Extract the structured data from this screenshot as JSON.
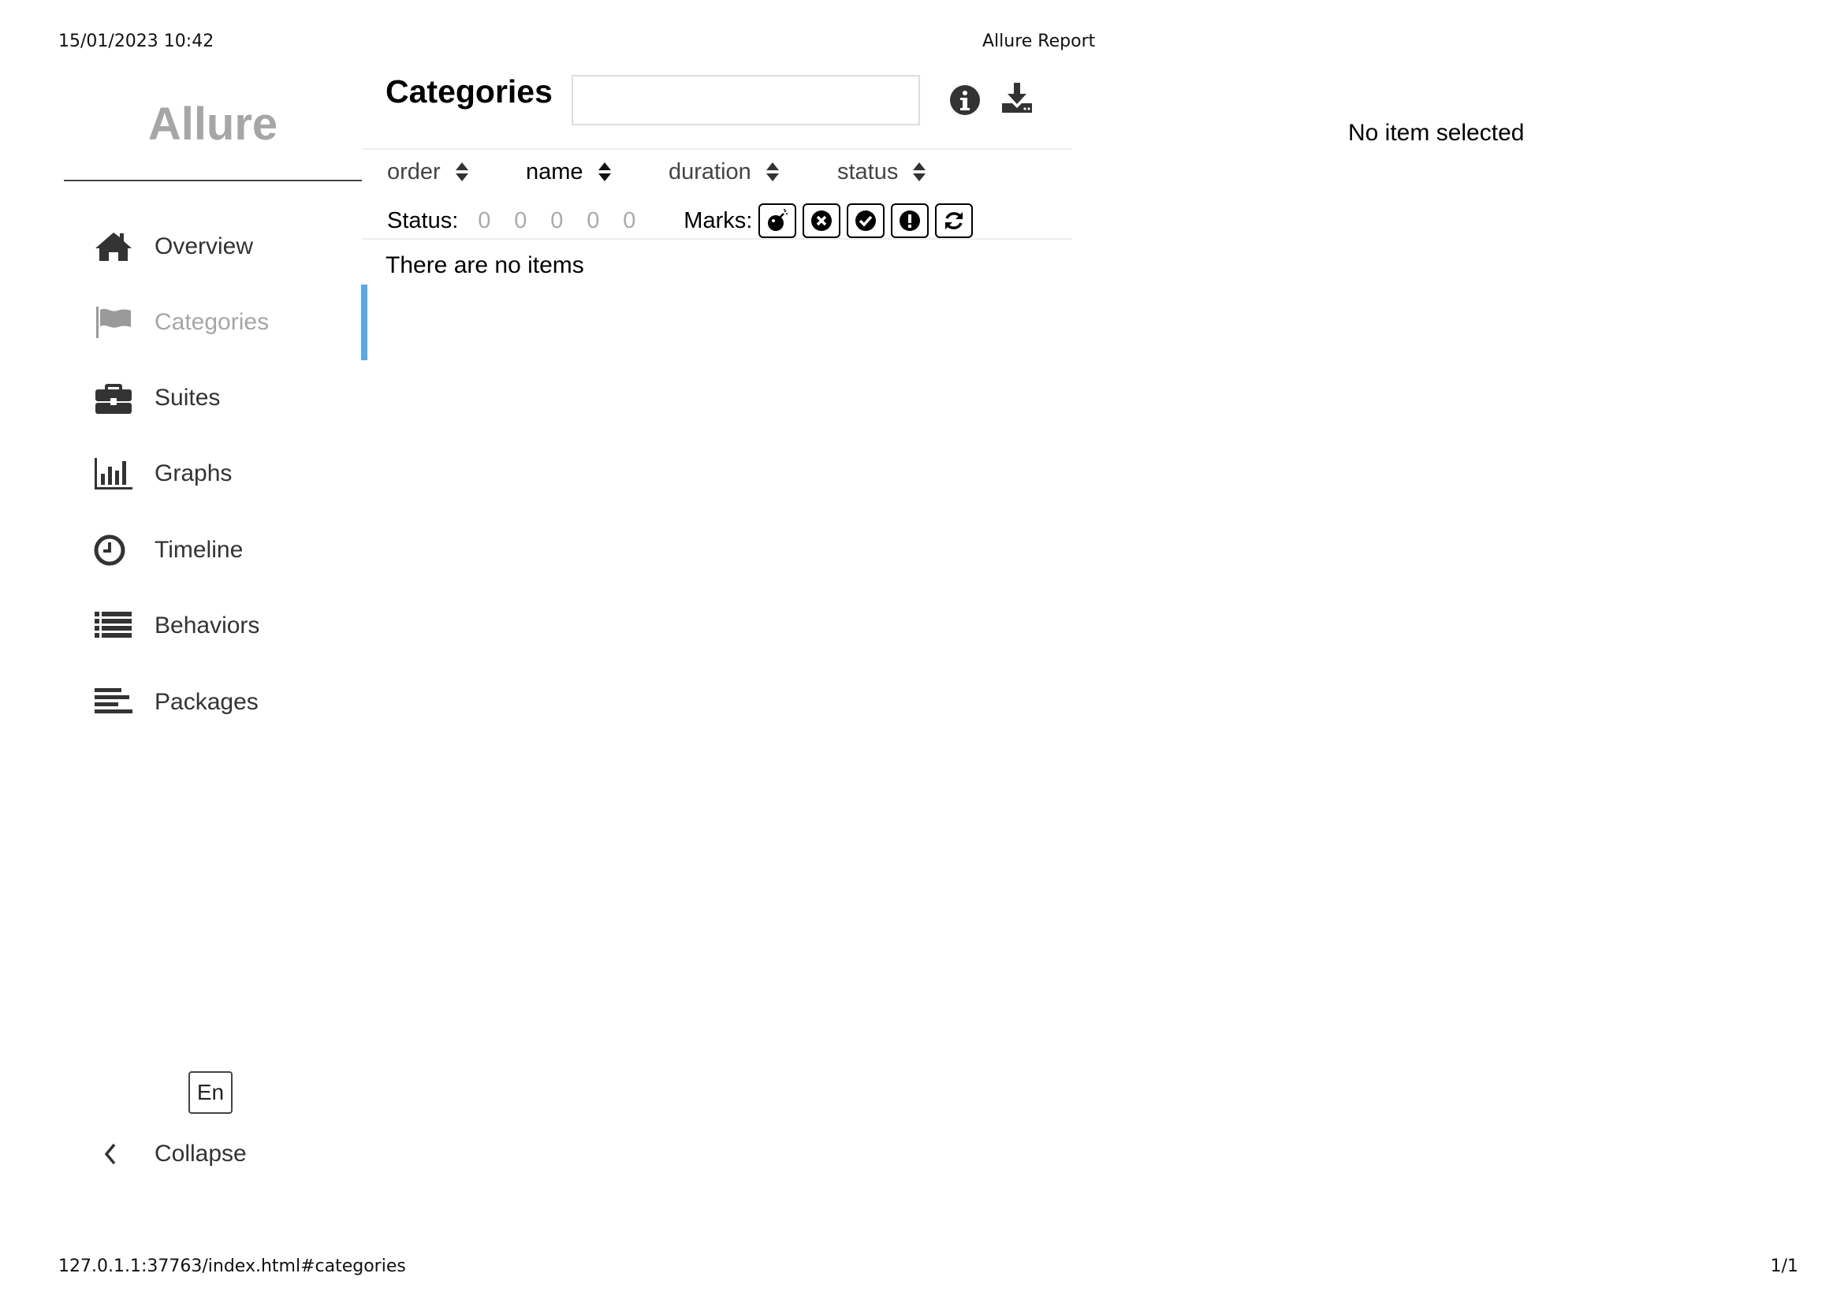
{
  "print": {
    "datetime": "15/01/2023 10:42",
    "title": "Allure Report",
    "url": "127.0.1.1:37763/index.html#categories",
    "page": "1/1"
  },
  "sidebar": {
    "brand": "Allure",
    "items": [
      {
        "label": "Overview",
        "icon": "home-icon",
        "active": false
      },
      {
        "label": "Categories",
        "icon": "flag-icon",
        "active": true
      },
      {
        "label": "Suites",
        "icon": "briefcase-icon",
        "active": false
      },
      {
        "label": "Graphs",
        "icon": "bar-chart-icon",
        "active": false
      },
      {
        "label": "Timeline",
        "icon": "clock-icon",
        "active": false
      },
      {
        "label": "Behaviors",
        "icon": "list-icon",
        "active": false
      },
      {
        "label": "Packages",
        "icon": "align-left-icon",
        "active": false
      }
    ],
    "language": "En",
    "collapse_label": "Collapse",
    "active_color": "#5aa9e6"
  },
  "main": {
    "title": "Categories",
    "search": {
      "value": "",
      "placeholder": ""
    },
    "sort_columns": [
      "order",
      "name",
      "duration",
      "status"
    ],
    "active_sort": "name",
    "status_label": "Status:",
    "status_counts": [
      "0",
      "0",
      "0",
      "0",
      "0"
    ],
    "marks_label": "Marks:",
    "marks": [
      "bomb-icon",
      "times-circle-icon",
      "check-circle-icon",
      "exclamation-circle-icon",
      "refresh-icon"
    ],
    "empty_message": "There are no items"
  },
  "detail": {
    "empty_message": "No item selected"
  }
}
